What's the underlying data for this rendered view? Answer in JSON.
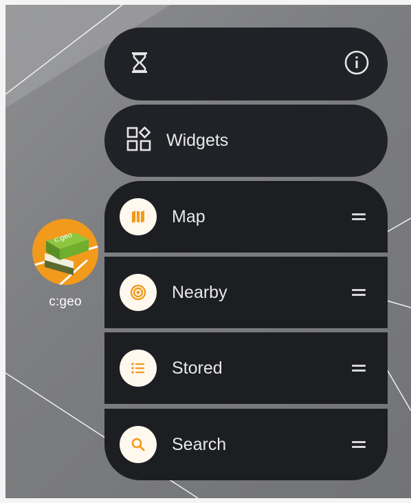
{
  "app": {
    "name": "c:geo",
    "icon": "cgeo-logo-icon"
  },
  "popup": {
    "timer_icon": "hourglass-icon",
    "info_icon": "info-icon",
    "widgets": {
      "label": "Widgets",
      "icon": "widgets-icon"
    },
    "shortcuts": [
      {
        "label": "Map",
        "icon": "map-icon"
      },
      {
        "label": "Nearby",
        "icon": "nearby-icon"
      },
      {
        "label": "Stored",
        "icon": "list-icon"
      },
      {
        "label": "Search",
        "icon": "search-icon"
      }
    ],
    "drag_handle_icon": "drag-handle-icon"
  },
  "colors": {
    "panel": "#202227",
    "accent": "#f29a1b",
    "icon_bg": "#fff8ee",
    "text": "#e8e8e8"
  }
}
